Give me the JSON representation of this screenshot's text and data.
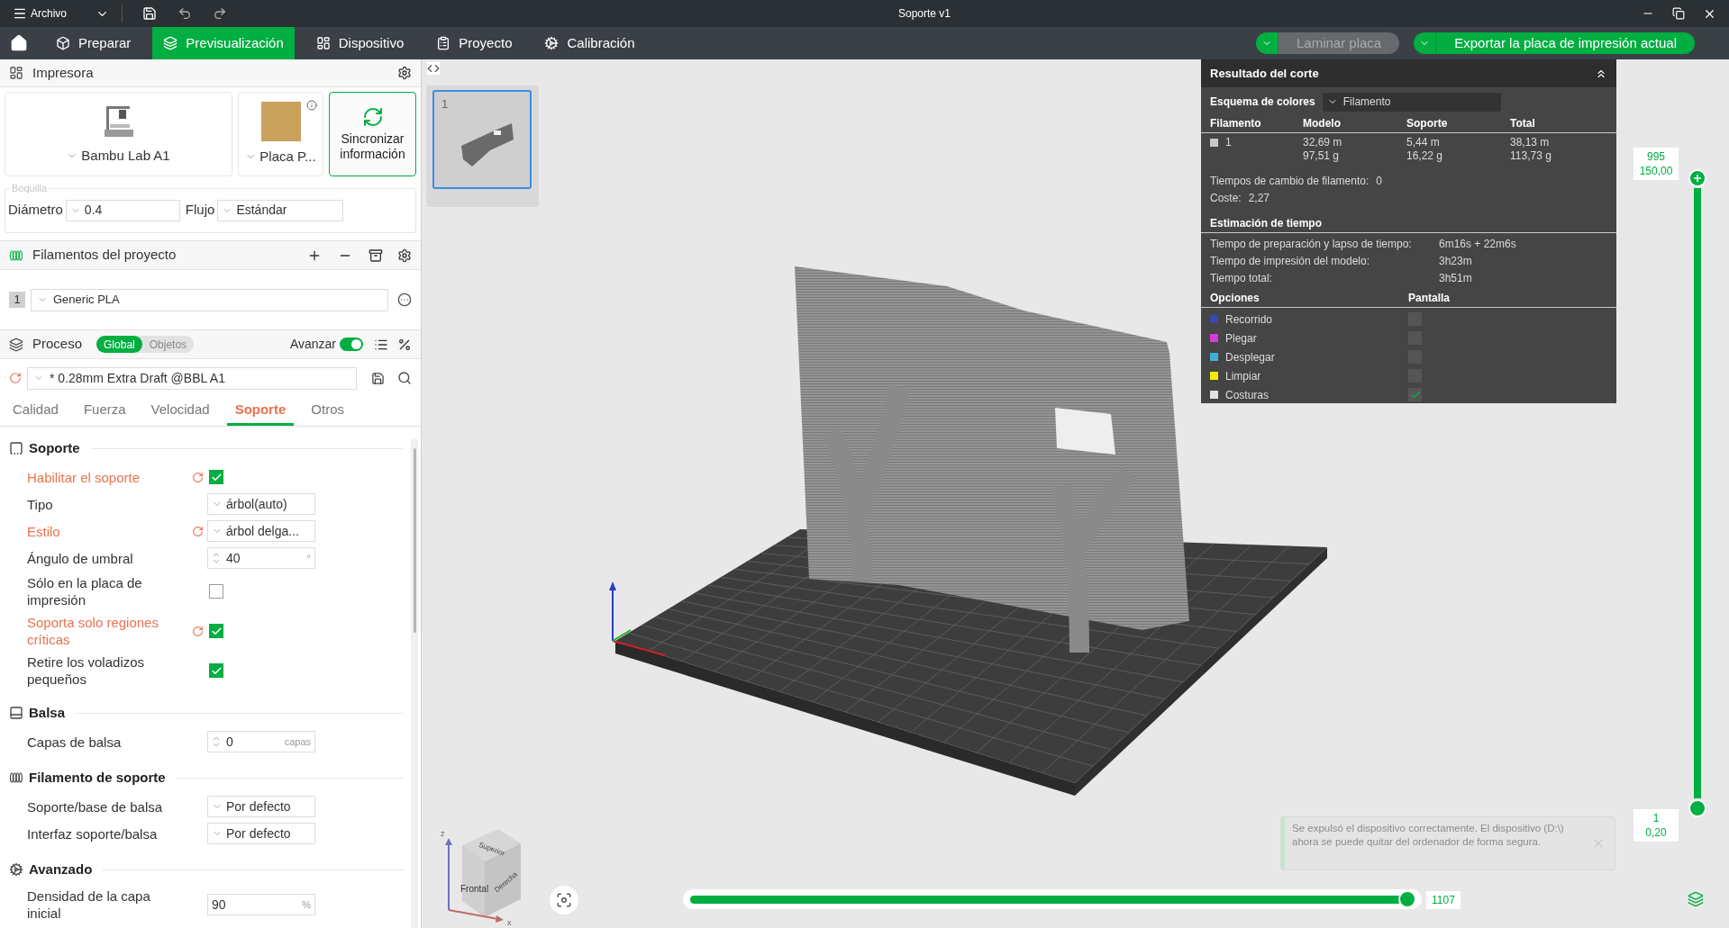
{
  "window": {
    "menu": "Archivo",
    "title": "Soporte v1"
  },
  "nav_tabs": [
    {
      "label": "Preparar",
      "selected": false
    },
    {
      "label": "Previsualización",
      "selected": true
    },
    {
      "label": "Dispositivo",
      "selected": false
    },
    {
      "label": "Proyecto",
      "selected": false
    },
    {
      "label": "Calibración",
      "selected": false
    }
  ],
  "actions": [
    {
      "label": "Laminar placa",
      "disabled": true
    },
    {
      "label": "Exportar la placa de impresión actual",
      "disabled": false
    }
  ],
  "printer": {
    "title": "Impresora",
    "model": "Bambu Lab A1",
    "plate": "Placa P...",
    "sync": "Sincronizar información",
    "nozzle": {
      "legend": "Boquilla",
      "fields": [
        {
          "label": "Diámetro",
          "value": "0.4"
        },
        {
          "label": "Flujo",
          "value": "Estándar"
        }
      ]
    }
  },
  "filaments": {
    "title": "Filamentos del proyecto",
    "items": [
      {
        "number": "1",
        "name": "Generic PLA"
      }
    ]
  },
  "process": {
    "title": "Proceso",
    "scope": [
      {
        "label": "Global",
        "selected": true
      },
      {
        "label": "Objetos",
        "selected": false
      }
    ],
    "advanced": {
      "label": "Avanzar",
      "on": true
    },
    "preset": {
      "value": "* 0.28mm Extra Draft @BBL A1",
      "modified": true
    },
    "tabs": [
      {
        "label": "Calidad",
        "selected": false
      },
      {
        "label": "Fuerza",
        "selected": false
      },
      {
        "label": "Velocidad",
        "selected": false
      },
      {
        "label": "Soporte",
        "selected": true
      },
      {
        "label": "Otros",
        "selected": false
      }
    ],
    "sections": [
      {
        "title": "Soporte",
        "settings": [
          {
            "kind": "checkbox",
            "label": "Habilitar el soporte",
            "modified": true,
            "checked": true
          },
          {
            "kind": "select",
            "label": "Tipo",
            "modified": false,
            "value": "árbol(auto)"
          },
          {
            "kind": "select",
            "label": "Estilo",
            "modified": true,
            "value": "árbol delga..."
          },
          {
            "kind": "spin",
            "label": "Ángulo de umbral",
            "modified": false,
            "value": "40",
            "unit": "°"
          },
          {
            "kind": "checkbox",
            "label": "Sólo en la placa de impresión",
            "modified": false,
            "checked": false
          },
          {
            "kind": "checkbox",
            "label": "Soporta solo regiones críticas",
            "modified": true,
            "checked": true
          },
          {
            "kind": "checkbox",
            "label": "Retire los voladizos pequeños",
            "modified": false,
            "checked": true
          }
        ]
      },
      {
        "title": "Balsa",
        "settings": [
          {
            "kind": "spin",
            "label": "Capas de balsa",
            "modified": false,
            "value": "0",
            "unit": "capas"
          }
        ]
      },
      {
        "title": "Filamento de soporte",
        "settings": [
          {
            "kind": "select",
            "label": "Soporte/base de balsa",
            "modified": false,
            "value": "Por defecto"
          },
          {
            "kind": "select",
            "label": "Interfaz soporte/balsa",
            "modified": false,
            "value": "Por defecto"
          }
        ]
      },
      {
        "title": "Avanzado",
        "settings": [
          {
            "kind": "input",
            "label": "Densidad de la capa inicial",
            "modified": false,
            "value": "90",
            "unit": "%"
          }
        ]
      }
    ]
  },
  "plates": [
    {
      "number": "1",
      "selected": true
    }
  ],
  "slice_result": {
    "title": "Resultado del corte",
    "scheme_label": "Esquema de colores",
    "scheme_value": "Filamento",
    "columns": [
      "Filamento",
      "Modelo",
      "Soporte",
      "Total"
    ],
    "rows": [
      {
        "color": "#c8c8c8",
        "cells": [
          [
            "1"
          ],
          [
            "32,69 m",
            "97,51 g"
          ],
          [
            "5,44 m",
            "16,22 g"
          ],
          [
            "38,13 m",
            "113,73 g"
          ]
        ]
      }
    ],
    "summary": [
      {
        "label": "Tiempos de cambio de filamento:",
        "value": "0"
      },
      {
        "label": "Coste:",
        "value": "2,27"
      }
    ],
    "time": {
      "title": "Estimación de tiempo",
      "rows": [
        {
          "label": "Tiempo de preparación y lapso de tiempo:",
          "value": "6m16s + 22m6s"
        },
        {
          "label": "Tiempo de impresión del modelo:",
          "value": "3h23m"
        },
        {
          "label": "Tiempo total:",
          "value": "3h51m"
        }
      ]
    },
    "options": {
      "columns": [
        "Opciones",
        "Pantalla"
      ],
      "items": [
        {
          "label": "Recorrido",
          "color": "#3a48a8",
          "checked": false
        },
        {
          "label": "Plegar",
          "color": "#d83ad8",
          "checked": false
        },
        {
          "label": "Desplegar",
          "color": "#40aedb",
          "checked": false
        },
        {
          "label": "Limpiar",
          "color": "#f2ee00",
          "checked": false
        },
        {
          "label": "Costuras",
          "color": "#e2e2e2",
          "checked": true
        }
      ]
    }
  },
  "layer_slider": {
    "upper": [
      "995",
      "150,00"
    ],
    "lower": [
      "1",
      "0,20"
    ],
    "level": 1
  },
  "move_slider": {
    "value": "1107",
    "level": 0.99
  },
  "notification": {
    "text": "Se expulsó el dispositivo correctamente. El dispositivo (D:\\) ahora se puede quitar del ordenador de forma segura."
  },
  "view_cube": {
    "faces": [
      "Superior",
      "Frontal",
      "Derecha"
    ],
    "axes": [
      "z",
      "x"
    ]
  }
}
